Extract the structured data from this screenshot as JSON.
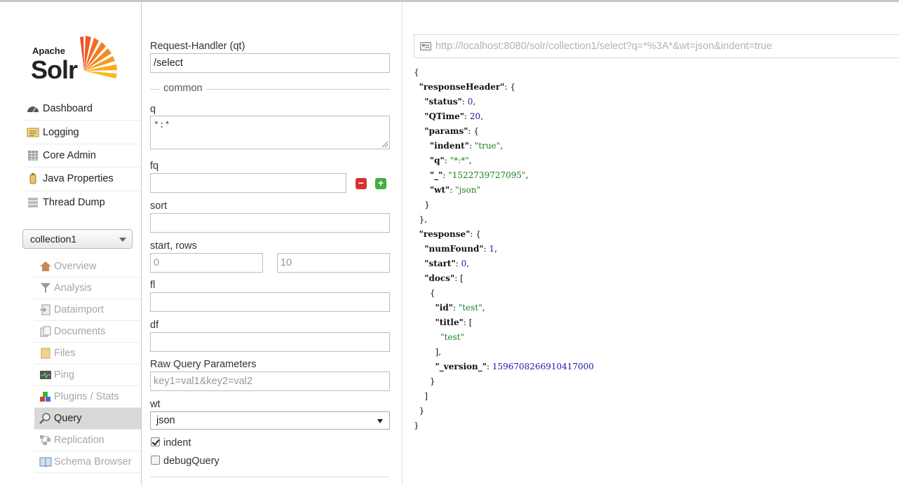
{
  "logo": {
    "apache": "Apache",
    "solr": "Solr"
  },
  "main_menu": [
    {
      "label": "Dashboard",
      "icon": "dashboard-icon"
    },
    {
      "label": "Logging",
      "icon": "logging-icon"
    },
    {
      "label": "Core Admin",
      "icon": "core-admin-icon"
    },
    {
      "label": "Java Properties",
      "icon": "java-icon"
    },
    {
      "label": "Thread Dump",
      "icon": "thread-dump-icon"
    }
  ],
  "core_selector": {
    "value": "collection1"
  },
  "core_menu": [
    {
      "label": "Overview",
      "icon": "home-icon"
    },
    {
      "label": "Analysis",
      "icon": "funnel-icon"
    },
    {
      "label": "Dataimport",
      "icon": "import-icon"
    },
    {
      "label": "Documents",
      "icon": "documents-icon"
    },
    {
      "label": "Files",
      "icon": "folder-icon"
    },
    {
      "label": "Ping",
      "icon": "ping-icon"
    },
    {
      "label": "Plugins / Stats",
      "icon": "plugins-icon"
    },
    {
      "label": "Query",
      "icon": "magnifier-icon",
      "active": true
    },
    {
      "label": "Replication",
      "icon": "replication-icon"
    },
    {
      "label": "Schema Browser",
      "icon": "schema-icon"
    }
  ],
  "form": {
    "qt_label": "Request-Handler (qt)",
    "qt_value": "/select",
    "common_legend": "common",
    "q_label": "q",
    "q_value": "*:*",
    "fq_label": "fq",
    "fq_value": "",
    "sort_label": "sort",
    "sort_value": "",
    "start_rows_label": "start, rows",
    "start_placeholder": "0",
    "rows_placeholder": "10",
    "fl_label": "fl",
    "fl_value": "",
    "df_label": "df",
    "df_value": "",
    "raw_label": "Raw Query Parameters",
    "raw_placeholder": "key1=val1&key2=val2",
    "wt_label": "wt",
    "wt_value": "json",
    "indent_label": "indent",
    "indent_checked": true,
    "debug_label": "debugQuery",
    "debug_checked": false,
    "minus": "−",
    "plus": "+"
  },
  "response": {
    "url": "http://localhost:8080/solr/collection1/select?q=*%3A*&wt=json&indent=true",
    "json_lines": [
      [
        [
          "p",
          "{"
        ]
      ],
      [
        [
          "p",
          "  "
        ],
        [
          "k",
          "\"responseHeader\""
        ],
        [
          "p",
          ": {"
        ]
      ],
      [
        [
          "p",
          "    "
        ],
        [
          "k",
          "\"status\""
        ],
        [
          "p",
          ": "
        ],
        [
          "n",
          "0"
        ],
        [
          "p",
          ","
        ]
      ],
      [
        [
          "p",
          "    "
        ],
        [
          "k",
          "\"QTime\""
        ],
        [
          "p",
          ": "
        ],
        [
          "n",
          "20"
        ],
        [
          "p",
          ","
        ]
      ],
      [
        [
          "p",
          "    "
        ],
        [
          "k",
          "\"params\""
        ],
        [
          "p",
          ": {"
        ]
      ],
      [
        [
          "p",
          "      "
        ],
        [
          "k",
          "\"indent\""
        ],
        [
          "p",
          ": "
        ],
        [
          "s",
          "\"true\""
        ],
        [
          "p",
          ","
        ]
      ],
      [
        [
          "p",
          "      "
        ],
        [
          "k",
          "\"q\""
        ],
        [
          "p",
          ": "
        ],
        [
          "s",
          "\"*:*\""
        ],
        [
          "p",
          ","
        ]
      ],
      [
        [
          "p",
          "      "
        ],
        [
          "k",
          "\"_\""
        ],
        [
          "p",
          ": "
        ],
        [
          "s",
          "\"1522739727095\""
        ],
        [
          "p",
          ","
        ]
      ],
      [
        [
          "p",
          "      "
        ],
        [
          "k",
          "\"wt\""
        ],
        [
          "p",
          ": "
        ],
        [
          "s",
          "\"json\""
        ]
      ],
      [
        [
          "p",
          "    }"
        ]
      ],
      [
        [
          "p",
          "  },"
        ]
      ],
      [
        [
          "p",
          "  "
        ],
        [
          "k",
          "\"response\""
        ],
        [
          "p",
          ": {"
        ]
      ],
      [
        [
          "p",
          "    "
        ],
        [
          "k",
          "\"numFound\""
        ],
        [
          "p",
          ": "
        ],
        [
          "n",
          "1"
        ],
        [
          "p",
          ","
        ]
      ],
      [
        [
          "p",
          "    "
        ],
        [
          "k",
          "\"start\""
        ],
        [
          "p",
          ": "
        ],
        [
          "n",
          "0"
        ],
        [
          "p",
          ","
        ]
      ],
      [
        [
          "p",
          "    "
        ],
        [
          "k",
          "\"docs\""
        ],
        [
          "p",
          ": ["
        ]
      ],
      [
        [
          "p",
          "      {"
        ]
      ],
      [
        [
          "p",
          "        "
        ],
        [
          "k",
          "\"id\""
        ],
        [
          "p",
          ": "
        ],
        [
          "s",
          "\"test\""
        ],
        [
          "p",
          ","
        ]
      ],
      [
        [
          "p",
          "        "
        ],
        [
          "k",
          "\"title\""
        ],
        [
          "p",
          ": ["
        ]
      ],
      [
        [
          "p",
          "          "
        ],
        [
          "s",
          "\"test\""
        ]
      ],
      [
        [
          "p",
          "        ],"
        ]
      ],
      [
        [
          "p",
          "        "
        ],
        [
          "k",
          "\"_version_\""
        ],
        [
          "p",
          ": "
        ],
        [
          "n",
          "1596708266910417000"
        ]
      ],
      [
        [
          "p",
          "      }"
        ]
      ],
      [
        [
          "p",
          "    ]"
        ]
      ],
      [
        [
          "p",
          "  }"
        ]
      ],
      [
        [
          "p",
          "}"
        ]
      ]
    ]
  },
  "colors": {
    "accent": "#f47b20",
    "string": "#1a7f1a",
    "number": "#1a1aa8",
    "active_bg": "#d9d9d9"
  }
}
